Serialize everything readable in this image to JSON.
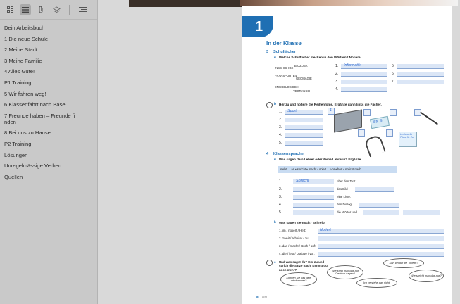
{
  "toolbar": {
    "icons": [
      "grid-icon",
      "list-icon",
      "attachment-icon",
      "layers-icon",
      "menu-icon"
    ]
  },
  "toc": [
    "Dein Arbeitsbuch",
    "1 Die neue Schule",
    "2 Meine Stadt",
    "3 Meine Familie",
    "4 Alles Gute!",
    "P1 Training",
    "5 Wir fahren weg!",
    "6 Klassenfahrt nach Basel",
    "7 Freunde haben – Freunde fi\nnden",
    "8 Bei uns zu Hause",
    "P2 Training",
    "Lösungen",
    "Unregelmässige Verben",
    "Quellen"
  ],
  "page": {
    "chapter_number": "1",
    "title": "In der Klasse",
    "sec3_num": "3",
    "sec3_title": "Schulfächer",
    "sec3a_label": "a",
    "sec3a_text": "Welche Schulfächer stecken in den Wörtern? Notiere.",
    "words": [
      "INSCHICHGE",
      "BIOZOBK",
      "FRANSPORTEIL",
      "GEOMAGIE",
      "ENGGELOSISCH",
      "TEGRAUSCH"
    ],
    "answer_1": "Informatik",
    "nums": [
      "1.",
      "2.",
      "3.",
      "4.",
      "5.",
      "6.",
      "7."
    ],
    "sec3b_label": "b",
    "sec3b_text": "Hör zu und notiere die Reihenfolge. Ergänze dann links die Fächer.",
    "sec3b_answer": "Sport",
    "sec3b_nums": [
      "1.",
      "2.",
      "3.",
      "4.",
      "5."
    ],
    "sec4_num": "4",
    "sec4_title": "Klassensprache",
    "sec4a_label": "a",
    "sec4a_text": "Was sagen dein Lehrer oder deine Lehrerin? Ergänze.",
    "word_bank": "sieht … an • spricht • macht • spielt … vor • hört • spricht nach",
    "sec4a_answer": "Sprecht",
    "sec4a_rows": [
      "über den Text.",
      "das Bild",
      "eine Liste.",
      "den Dialog",
      "die Wörter und"
    ],
    "sec4b_label": "b",
    "sec4b_text": "Was sagen sie noch? Schreib.",
    "sec4b_rows": [
      "1. im / notiert / Heft:",
      "2. zweit / arbeitet / zu:",
      "3. das / macht / Buch / auf:",
      "4. die / lest / Dialoge / vor:"
    ],
    "sec4b_answer": "Notiert",
    "sec4c_label": "c",
    "sec4c_text": "Und was sagst du? Hör zu und sprich die Sätze nach. Kennst du noch mehr?",
    "bubbles": [
      "Darf ich auf die Toilette?",
      "Wie kann man das auf Deutsch sagen?",
      "Können Sie das bitte wiederholen?",
      "Wie spricht man das aus?",
      "Ich verstehe das nicht."
    ],
    "card_text": "Str. 5",
    "sticky_text": "im Hand für Pfund für Eu",
    "footer_page": "8",
    "footer_text": "acht"
  }
}
